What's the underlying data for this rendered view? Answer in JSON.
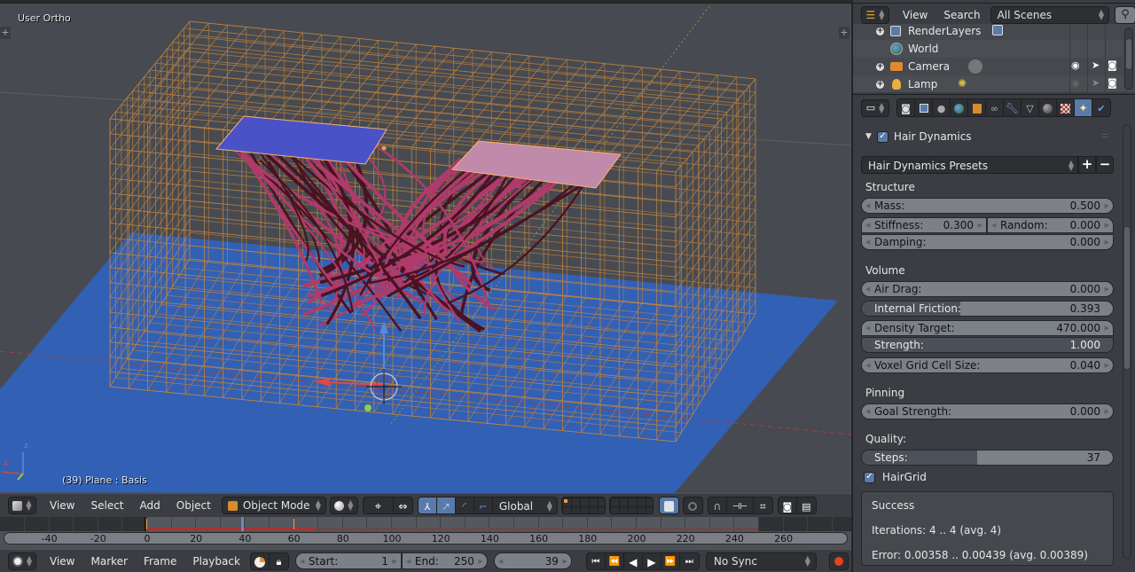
{
  "viewport": {
    "view_name": "User Ortho",
    "object_info": "(39) Plane : Basis",
    "axis_label_z": "z",
    "axis_label_x": "x",
    "colors": {
      "background": "#474a50",
      "floor_plane": "#3260b4",
      "grid_lattice": "#c0823e",
      "emitter_selected": "#4a52c8",
      "emitter_target": "#c08aaa",
      "hair": "#b03a6a",
      "hair_dark": "#4a1222"
    }
  },
  "view3d_header": {
    "editor_icon": "cube-icon",
    "menus": [
      "View",
      "Select",
      "Add",
      "Object"
    ],
    "mode": "Object Mode",
    "pivot": "Global"
  },
  "timeline": {
    "ticks": [
      "-40",
      "-20",
      "0",
      "20",
      "40",
      "60",
      "80",
      "100",
      "120",
      "140",
      "160",
      "180",
      "200",
      "220",
      "240",
      "260"
    ],
    "current_frame": 39,
    "cached_until_frame": 69,
    "keyframes": [
      0,
      60
    ]
  },
  "timeline_header": {
    "menus": [
      "View",
      "Marker",
      "Frame",
      "Playback"
    ],
    "start_label": "Start:",
    "start_value": "1",
    "end_label": "End:",
    "end_value": "250",
    "current_frame": "39",
    "sync": "No Sync"
  },
  "outliner": {
    "menus": [
      "View",
      "Search"
    ],
    "scene_filter": "All Scenes",
    "items": [
      {
        "name": "RenderLayers",
        "icon": "render-layers-icon",
        "expandable": true
      },
      {
        "name": "World",
        "icon": "world-icon",
        "expandable": false
      },
      {
        "name": "Camera",
        "icon": "camera-icon",
        "expandable": true
      },
      {
        "name": "Lamp",
        "icon": "lamp-icon",
        "expandable": true
      }
    ]
  },
  "properties": {
    "context_tabs": [
      "render",
      "render-layers",
      "scene",
      "world",
      "object",
      "constraints",
      "modifiers",
      "data",
      "material",
      "texture",
      "particles",
      "physics"
    ],
    "active_tab": "particles",
    "panel_title": "Hair Dynamics",
    "panel_enabled": true,
    "presets_label": "Hair Dynamics Presets",
    "sections": {
      "structure": "Structure",
      "volume": "Volume",
      "pinning": "Pinning",
      "quality": "Quality:"
    },
    "fields": {
      "mass": {
        "label": "Mass:",
        "value": "0.500"
      },
      "stiffness": {
        "label": "Stiffness:",
        "value": "0.300"
      },
      "random": {
        "label": "Random:",
        "value": "0.000"
      },
      "damping": {
        "label": "Damping:",
        "value": "0.000"
      },
      "air_drag": {
        "label": "Air Drag:",
        "value": "0.000"
      },
      "internal_friction": {
        "label": "Internal Friction:",
        "value": "0.393",
        "fraction": 0.393
      },
      "density_target": {
        "label": "Density Target:",
        "value": "470.000"
      },
      "strength": {
        "label": "Strength:",
        "value": "1.000"
      },
      "voxel_size": {
        "label": "Voxel Grid Cell Size:",
        "value": "0.040"
      },
      "goal_strength": {
        "label": "Goal Strength:",
        "value": "0.000"
      },
      "steps": {
        "label": "Steps:",
        "value": "37",
        "fraction": 0.46
      }
    },
    "hairgrid_label": "HairGrid",
    "hairgrid_enabled": true,
    "result": {
      "status": "Success",
      "iterations": "Iterations: 4 .. 4 (avg. 4)",
      "error": "Error: 0.00358 .. 0.00439 (avg. 0.00389)"
    }
  }
}
